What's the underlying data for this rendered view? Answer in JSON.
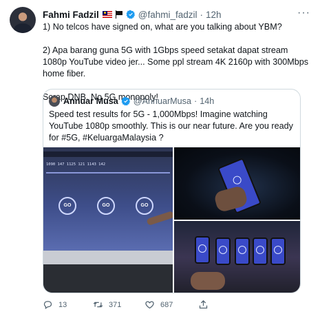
{
  "tweet": {
    "author_name": "Fahmi Fadzil",
    "author_handle": "@fahmi_fadzil",
    "separator": "·",
    "time": "12h",
    "more_label": "···",
    "text_line1": "1) No telcos have signed on, what are you talking about YBM?",
    "text_line2": "2) Apa barang guna 5G with 1Gbps speed setakat dapat stream 1080p YouTube video jer... Some ppl stream 4K 2160p with 300Mbps home fiber.",
    "text_line3": "Scrap DNB. No 5G monopoly!",
    "icons": [
      "malaysia-flag-icon",
      "black-flag-icon",
      "verified-badge-icon"
    ]
  },
  "quote": {
    "author_name": "Annuar Musa",
    "author_handle": "@AnnuarMusa",
    "separator": "·",
    "time": "14h",
    "text": "Speed test results for 5G - 1,000Mbps! Imagine watching YouTube 1080p smoothly. This is our near future. Are you ready for #5G, #KeluargaMalaysia ?",
    "screen": {
      "row1": "1090   147   1125   121   1143   142",
      "go": "GO"
    }
  },
  "actions": {
    "reply_count": "13",
    "retweet_count": "371",
    "like_count": "687"
  },
  "colors": {
    "text": "#0f1419",
    "secondary": "#536471",
    "verified": "#1d9bf0",
    "border": "#cfd9de"
  }
}
